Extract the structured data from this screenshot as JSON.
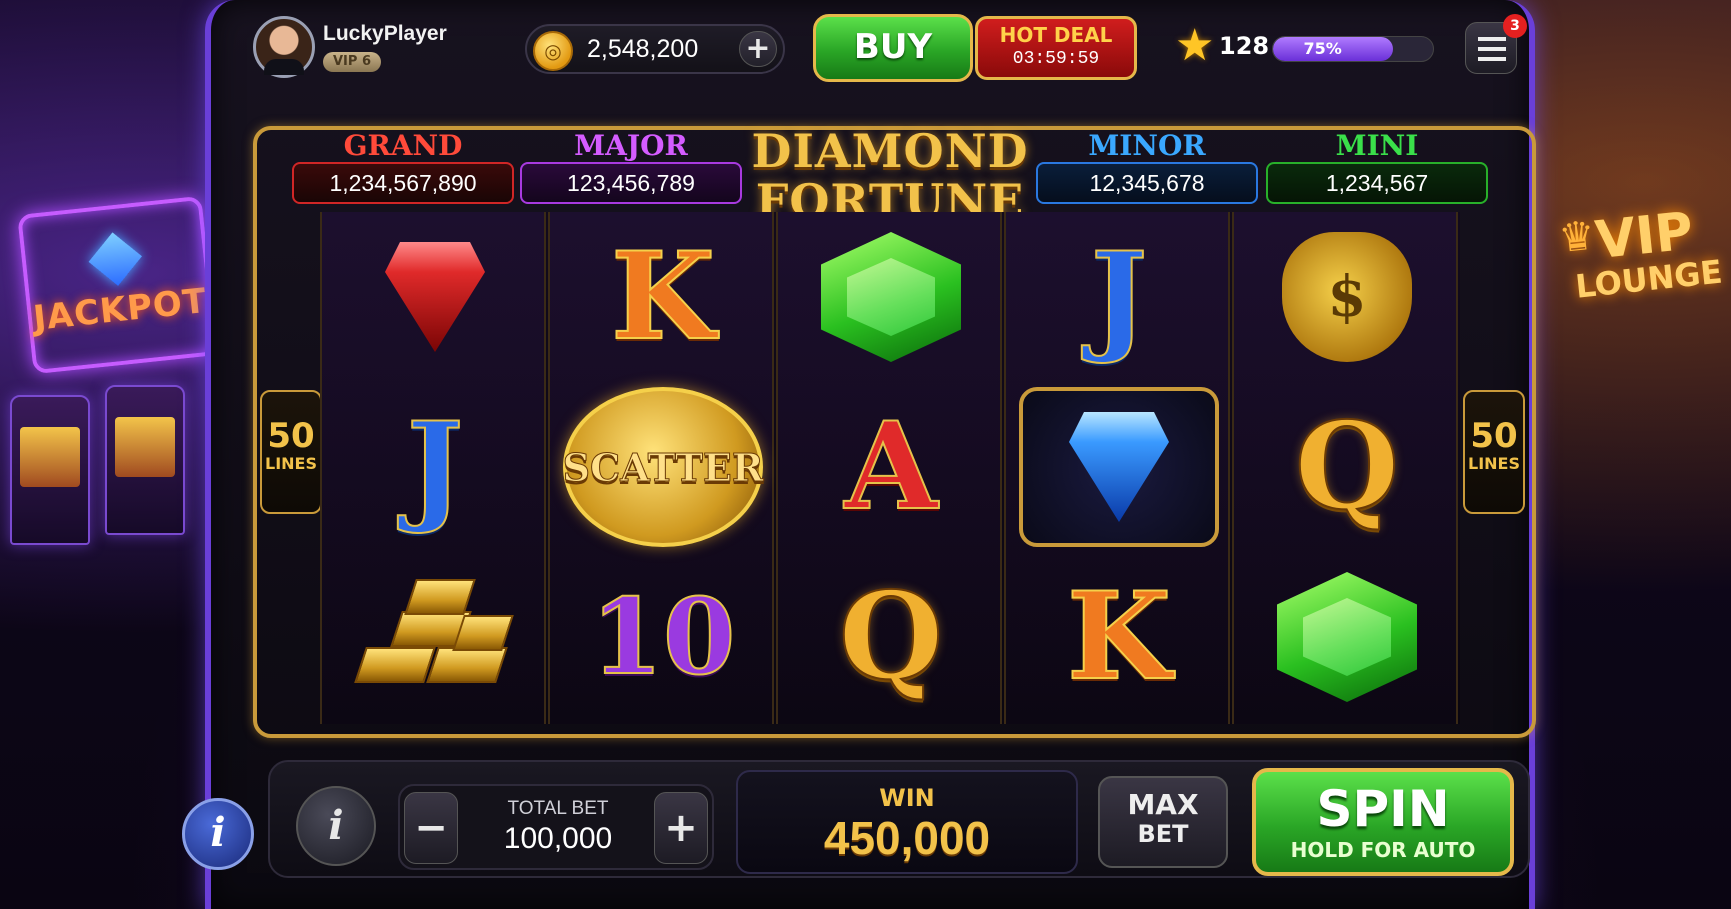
{
  "background": {
    "left_sign": "JACKPOT",
    "right_sign_line1": "VIP",
    "right_sign_line2": "LOUNGE"
  },
  "header": {
    "username": "LuckyPlayer",
    "vip_badge": "VIP 6",
    "coin_balance": "2,548,200",
    "buy_label": "BUY",
    "hot_deal_label": "HOT DEAL",
    "hot_deal_timer": "03:59:59",
    "level": "128",
    "xp_progress_text": "75%",
    "xp_progress": 0.75,
    "notification_count": "3"
  },
  "game": {
    "title_line1": "DIAMOND",
    "title_line2": "FORTUNE",
    "jackpots": {
      "grand": {
        "label": "GRAND",
        "value": "1,234,567,890"
      },
      "major": {
        "label": "MAJOR",
        "value": "123,456,789"
      },
      "minor": {
        "label": "MINOR",
        "value": "12,345,678"
      },
      "mini": {
        "label": "MINI",
        "value": "1,234,567"
      }
    },
    "lines_count": "50",
    "lines_label": "LINES",
    "reels": [
      [
        "red-diamond",
        "J",
        "gold-bars"
      ],
      [
        "K",
        "SCATTER",
        "10"
      ],
      [
        "green-emerald",
        "A",
        "Q"
      ],
      [
        "J",
        "blue-diamond",
        "K"
      ],
      [
        "money-bag",
        "Q",
        "green-emerald"
      ]
    ],
    "scatter_text": "SCATTER"
  },
  "controls": {
    "info_symbol": "i",
    "total_bet_label": "TOTAL BET",
    "total_bet_value": "100,000",
    "minus_symbol": "−",
    "plus_symbol": "+",
    "win_label": "WIN",
    "win_value": "450,000",
    "max_bet_line1": "MAX",
    "max_bet_line2": "BET",
    "spin_label": "SPIN",
    "spin_sublabel": "HOLD FOR AUTO"
  },
  "colors": {
    "grand": "#ff4a3a",
    "major": "#d45cff",
    "minor": "#3aa8ff",
    "mini": "#3ae04a",
    "gold": "#f2c24a",
    "spin_green": "#2aa626"
  }
}
